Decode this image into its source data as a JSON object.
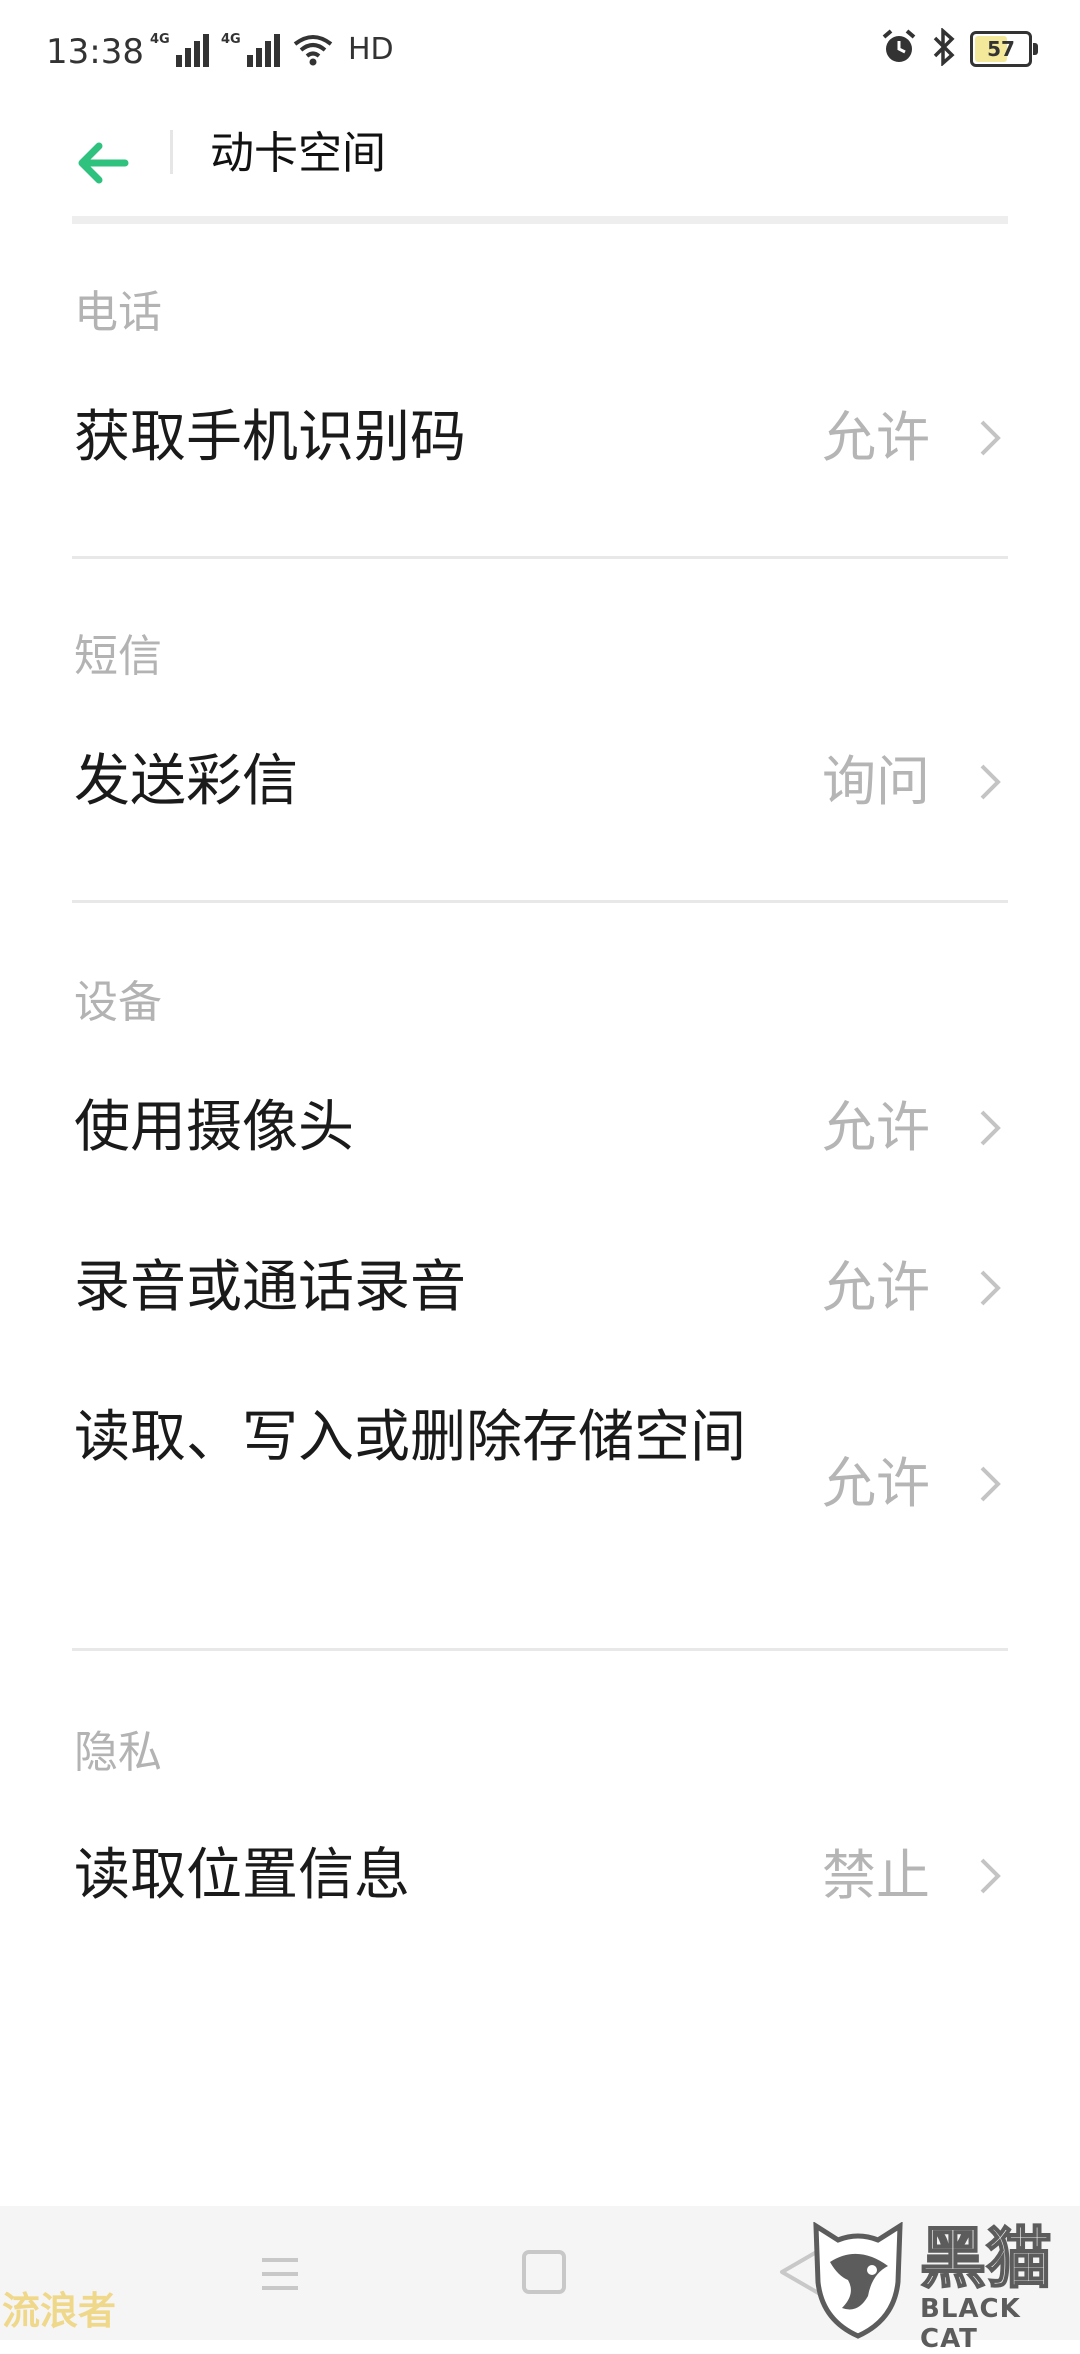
{
  "status_bar": {
    "time": "13:38",
    "network_1": "4G",
    "network_2": "4G",
    "hd_label": "HD",
    "battery_level": "57",
    "icons": [
      "signal-icon",
      "signal-icon",
      "wifi-icon",
      "alarm-icon",
      "bluetooth-icon",
      "battery-icon"
    ]
  },
  "header": {
    "title": "动卡空间",
    "back_icon": "arrow-left-icon",
    "accent_color": "#2ec27e"
  },
  "sections": [
    {
      "label": "电话",
      "items": [
        {
          "label": "获取手机识别码",
          "value": "允许"
        }
      ]
    },
    {
      "label": "短信",
      "items": [
        {
          "label": "发送彩信",
          "value": "询问"
        }
      ]
    },
    {
      "label": "设备",
      "items": [
        {
          "label": "使用摄像头",
          "value": "允许"
        },
        {
          "label": "录音或通话录音",
          "value": "允许"
        },
        {
          "label": "读取、写入或删除存储空间",
          "value": "允许"
        }
      ]
    },
    {
      "label": "隐私",
      "items": [
        {
          "label": "读取位置信息",
          "value": "禁止"
        }
      ]
    }
  ],
  "nav_bar": {
    "icons": [
      "menu-icon",
      "home-square-icon",
      "back-triangle-icon"
    ]
  },
  "watermark": {
    "left_text": "流浪者",
    "brand_cn": "黑猫",
    "brand_en": "BLACK CAT"
  }
}
